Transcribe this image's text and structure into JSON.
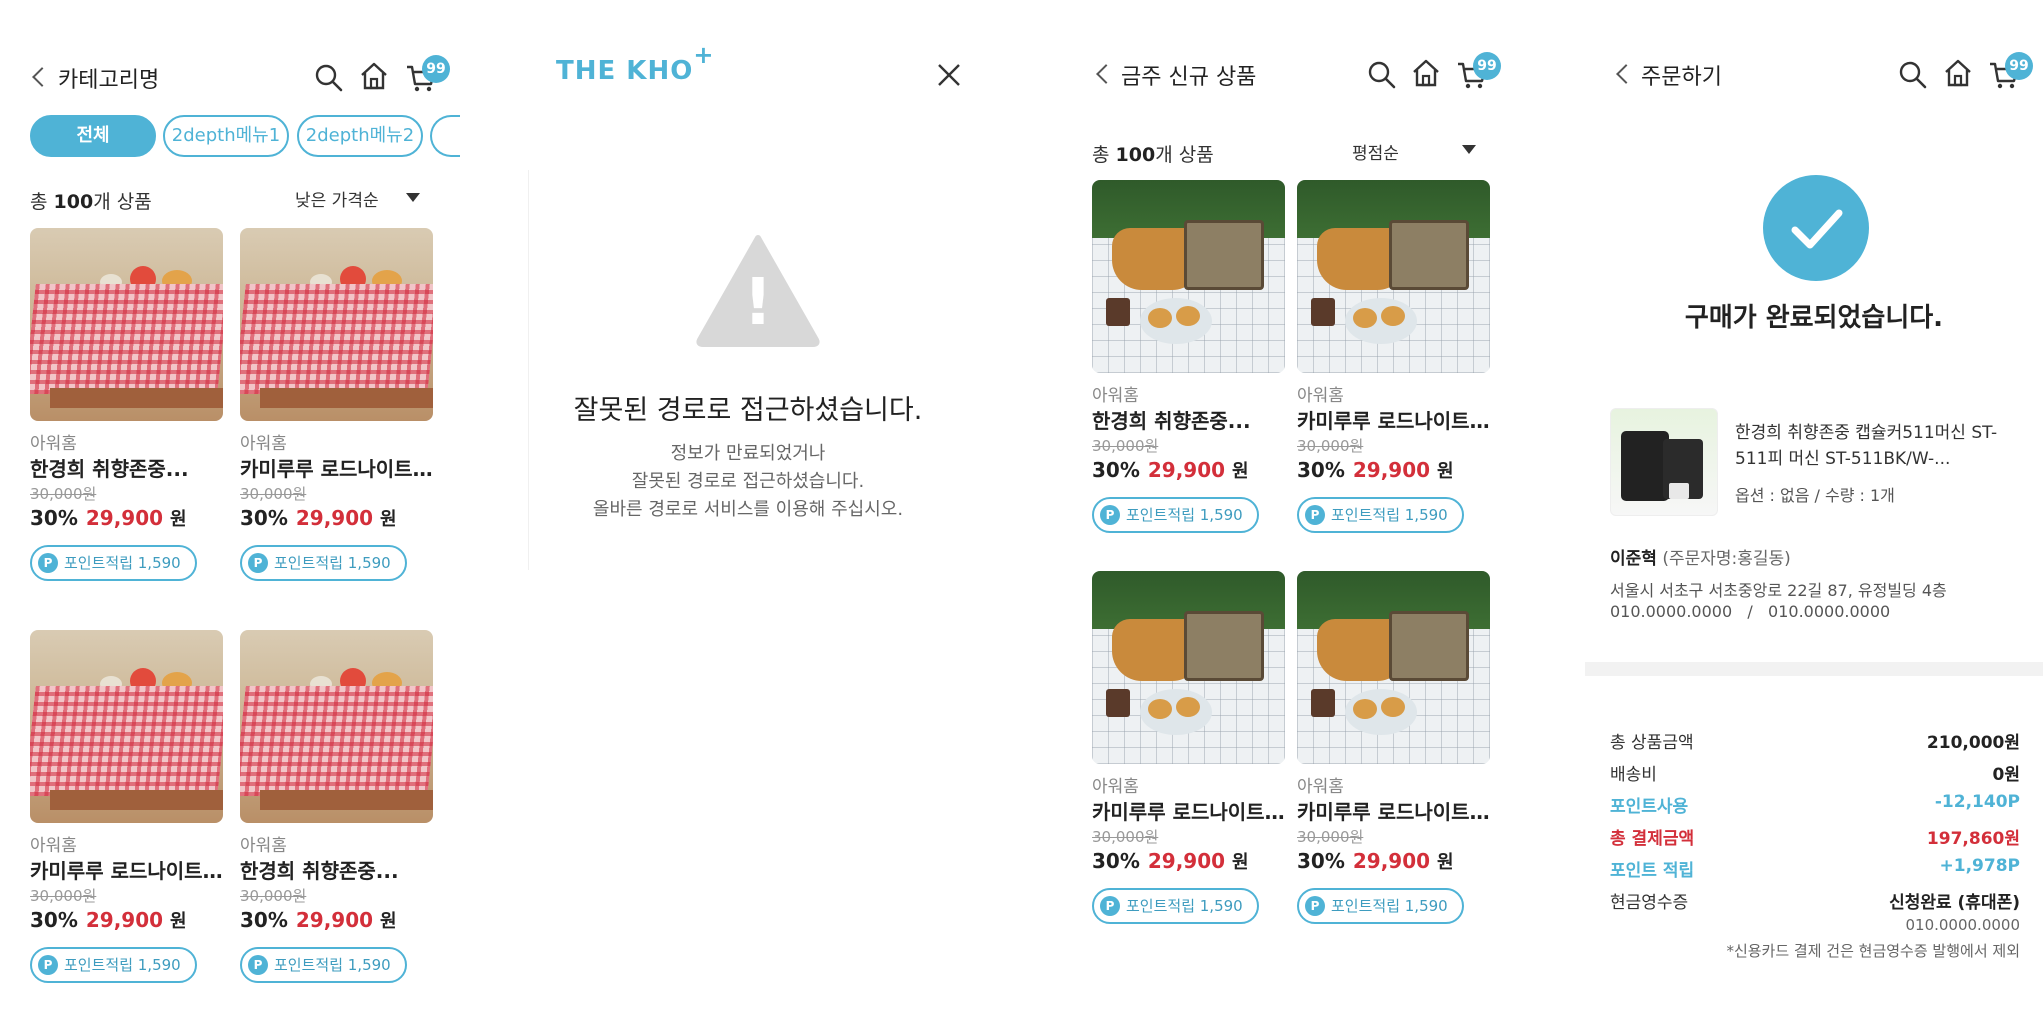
{
  "panel_category": {
    "title": "카테고리명",
    "cart_count": "99",
    "tabs": [
      "전체",
      "2depth메뉴1",
      "2depth메뉴2"
    ],
    "count_prefix": "총 ",
    "count_value": "100",
    "count_suffix": "개 상품",
    "sort_label": "낮은 가격순",
    "products": [
      {
        "brand": "아워홈",
        "name": "한경희 취향존중...",
        "orig_price": "30,000원",
        "discount": "30%",
        "price": "29,900",
        "won": "원",
        "point": "포인트적립 1,590",
        "image": "picnic"
      },
      {
        "brand": "아워홈",
        "name": "카미루루 로드나이트...",
        "orig_price": "30,000원",
        "discount": "30%",
        "price": "29,900",
        "won": "원",
        "point": "포인트적립 1,590",
        "image": "picnic"
      },
      {
        "brand": "아워홈",
        "name": "카미루루 로드나이트...",
        "orig_price": "30,000원",
        "discount": "30%",
        "price": "29,900",
        "won": "원",
        "point": "포인트적립 1,590",
        "image": "picnic"
      },
      {
        "brand": "아워홈",
        "name": "한경희 취향존중...",
        "orig_price": "30,000원",
        "discount": "30%",
        "price": "29,900",
        "won": "원",
        "point": "포인트적립 1,590",
        "image": "picnic"
      }
    ]
  },
  "panel_error": {
    "logo_text": "THE KHO",
    "logo_plus": "+",
    "title": "잘못된 경로로 접근하셨습니다.",
    "line1": "정보가 만료되었거나",
    "line2": "잘못된 경로로 접근하셨습니다.",
    "line3": "올바른 경로로 서비스를 이용해 주십시오.",
    "warning_mark": "!"
  },
  "panel_new": {
    "title": "금주 신규 상품",
    "cart_count": "99",
    "count_prefix": "총 ",
    "count_value": "100",
    "count_suffix": "개 상품",
    "sort_label": "평점순",
    "products": [
      {
        "brand": "아워홈",
        "name": "한경희 취향존중...",
        "orig_price": "30,000원",
        "discount": "30%",
        "price": "29,900",
        "won": "원",
        "point": "포인트적립 1,590",
        "image": "basket"
      },
      {
        "brand": "아워홈",
        "name": "카미루루 로드나이트...",
        "orig_price": "30,000원",
        "discount": "30%",
        "price": "29,900",
        "won": "원",
        "point": "포인트적립 1,590",
        "image": "basket"
      },
      {
        "brand": "아워홈",
        "name": "카미루루 로드나이트...",
        "orig_price": "30,000원",
        "discount": "30%",
        "price": "29,900",
        "won": "원",
        "point": "포인트적립 1,590",
        "image": "basket"
      },
      {
        "brand": "아워홈",
        "name": "카미루루 로드나이트...",
        "orig_price": "30,000원",
        "discount": "30%",
        "price": "29,900",
        "won": "원",
        "point": "포인트적립 1,590",
        "image": "basket"
      }
    ]
  },
  "panel_order": {
    "title": "주문하기",
    "cart_count": "99",
    "done_title": "구매가 완료되었습니다.",
    "product_name_1": "한경희 취향존중 캡슐커511머신 ST-",
    "product_name_2": "511피 머신 ST-511BK/W-...",
    "product_option": "옵션 : 없음 / 수량 : 1개",
    "buyer_name": "이준혁",
    "buyer_note": "(주문자명:홍길동)",
    "address": "서울시 서초구 서초중앙로 22길 87, 유정빌딩 4층",
    "phones": "010.0000.0000   /   010.0000.0000",
    "summary": [
      {
        "label": "총 상품금액",
        "value": "210,000원",
        "style": "normal"
      },
      {
        "label": "배송비",
        "value": "0원",
        "style": "normal"
      },
      {
        "label": "포인트사용",
        "value": "-12,140P",
        "style": "blue"
      },
      {
        "label": "총 결제금액",
        "value": "197,860원",
        "style": "red"
      },
      {
        "label": "포인트 적립",
        "value": "+1,978P",
        "style": "blue"
      },
      {
        "label": "현금영수증",
        "value": "신청완료 (휴대폰)",
        "style": "normal"
      }
    ],
    "receipt_phone": "010.0000.0000",
    "receipt_note": "*신용카드 결제 건은 현금영수증 발행에서 제외"
  }
}
